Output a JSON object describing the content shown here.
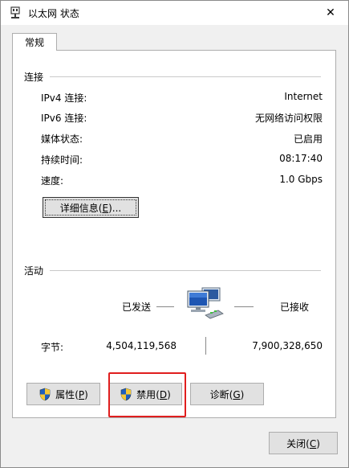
{
  "window": {
    "title": "以太网 状态",
    "close_glyph": "✕"
  },
  "tabs": [
    {
      "label": "常规"
    }
  ],
  "connection": {
    "heading": "连接",
    "rows": [
      {
        "label": "IPv4 连接:",
        "value": "Internet"
      },
      {
        "label": "IPv6 连接:",
        "value": "无网络访问权限"
      },
      {
        "label": "媒体状态:",
        "value": "已启用"
      },
      {
        "label": "持续时间:",
        "value": "08:17:40"
      },
      {
        "label": "速度:",
        "value": "1.0 Gbps"
      }
    ],
    "details_button": {
      "label": "详细信息",
      "accesskey": "E",
      "suffix": "..."
    }
  },
  "activity": {
    "heading": "活动",
    "sent_label": "已发送",
    "received_label": "已接收",
    "bytes_label": "字节:",
    "bytes_sent": "4,504,119,568",
    "bytes_received": "7,900,328,650"
  },
  "buttons": {
    "properties": {
      "label": "属性",
      "accesskey": "P"
    },
    "disable": {
      "label": "禁用",
      "accesskey": "D"
    },
    "diagnose": {
      "label": "诊断",
      "accesskey": "G"
    },
    "close": {
      "label": "关闭",
      "accesskey": "C"
    }
  },
  "colors": {
    "highlight_box": "#e01e1e",
    "panel_bg": "#ffffff",
    "dialog_bg": "#f0f0f0"
  },
  "icons": {
    "title": "network-adapter-icon",
    "activity": "network-computers-icon",
    "shield": "uac-shield-icon"
  }
}
